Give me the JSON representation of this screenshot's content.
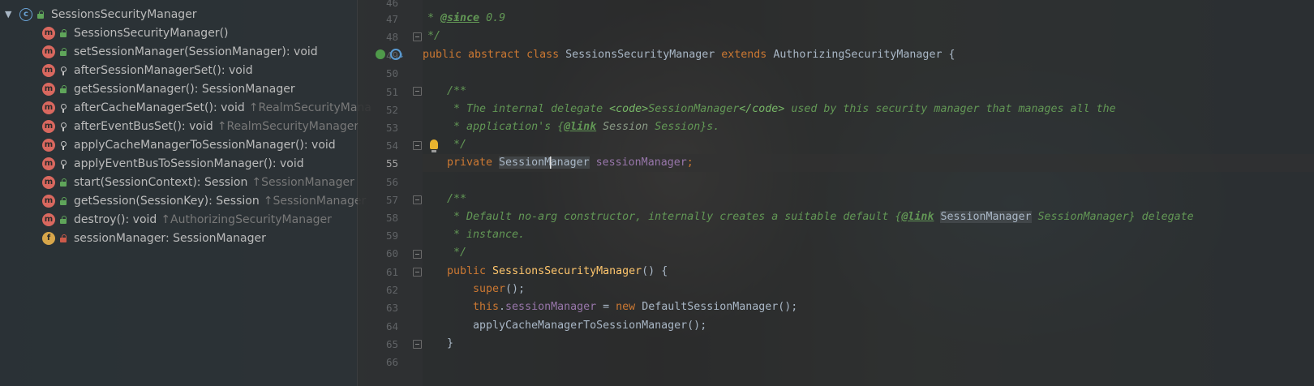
{
  "structure": {
    "root": {
      "name": "SessionsSecurityManager",
      "badge": "c"
    },
    "members": [
      {
        "badge": "m",
        "vis": "pub",
        "name": "SessionsSecurityManager()",
        "inherited": ""
      },
      {
        "badge": "m",
        "vis": "pub",
        "name": "setSessionManager(SessionManager): void",
        "inherited": ""
      },
      {
        "badge": "m",
        "vis": "prot",
        "name": "afterSessionManagerSet(): void",
        "inherited": ""
      },
      {
        "badge": "m",
        "vis": "pub",
        "name": "getSessionManager(): SessionManager",
        "inherited": ""
      },
      {
        "badge": "m",
        "vis": "prot",
        "name": "afterCacheManagerSet(): void",
        "inherited": "↑RealmSecurityMana"
      },
      {
        "badge": "m",
        "vis": "prot",
        "name": "afterEventBusSet(): void",
        "inherited": "↑RealmSecurityManager"
      },
      {
        "badge": "m",
        "vis": "prot",
        "name": "applyCacheManagerToSessionManager(): void",
        "inherited": ""
      },
      {
        "badge": "m",
        "vis": "prot",
        "name": "applyEventBusToSessionManager(): void",
        "inherited": ""
      },
      {
        "badge": "m",
        "vis": "pub",
        "name": "start(SessionContext): Session",
        "inherited": "↑SessionManager"
      },
      {
        "badge": "m",
        "vis": "pub",
        "name": "getSession(SessionKey): Session",
        "inherited": "↑SessionManager"
      },
      {
        "badge": "m",
        "vis": "pub",
        "name": "destroy(): void",
        "inherited": "↑AuthorizingSecurityManager"
      },
      {
        "badge": "f",
        "vis": "priv",
        "name": "sessionManager: SessionManager",
        "inherited": ""
      }
    ]
  },
  "editor": {
    "line_numbers": [
      "46",
      "47",
      "48",
      "49",
      "50",
      "51",
      "52",
      "53",
      "54",
      "55",
      "56",
      "57",
      "58",
      "59",
      "60",
      "61",
      "62",
      "63",
      "64",
      "65",
      "66"
    ],
    "current_line": "55",
    "code": {
      "l46": "*",
      "l47_tag": "@since",
      "l47_val": " 0.9",
      "l48": "*/",
      "l49_kw": "public abstract class ",
      "l49_name": "SessionsSecurityManager ",
      "l49_ext": "extends ",
      "l49_super": "AuthorizingSecurityManager {",
      "l51": "/**",
      "l52_a": " * The internal delegate ",
      "l52_code_open": "<code>",
      "l52_b": "SessionManager",
      "l52_code_close": "</code>",
      "l52_c": " used by this security manager that manages all the",
      "l53_a": " * application's {",
      "l53_link": "@link",
      "l53_b": " Session ",
      "l53_c": "Session}s.",
      "l54": " */",
      "l55_kw": "private ",
      "l55_type_a": "SessionM",
      "l55_type_b": "anager",
      "l55_field": " sessionManager",
      "l55_end": ";",
      "l57": "/**",
      "l58_a": " * Default no-arg constructor, internally creates a suitable default {",
      "l58_link": "@link",
      "l58_ref": "SessionManager",
      "l58_b": " SessionManager} delegate",
      "l59": " * instance.",
      "l60": " */",
      "l61_kw": "public ",
      "l61_name": "SessionsSecurityManager",
      "l61_rest": "() {",
      "l62_kw": "super",
      "l62_rest": "();",
      "l63_kw": "this",
      "l63_dot": ".",
      "l63_field": "sessionManager",
      "l63_eq": " = ",
      "l63_new": "new ",
      "l63_rest": "DefaultSessionManager();",
      "l64": "applyCacheManagerToSessionManager();",
      "l65": "}"
    }
  }
}
